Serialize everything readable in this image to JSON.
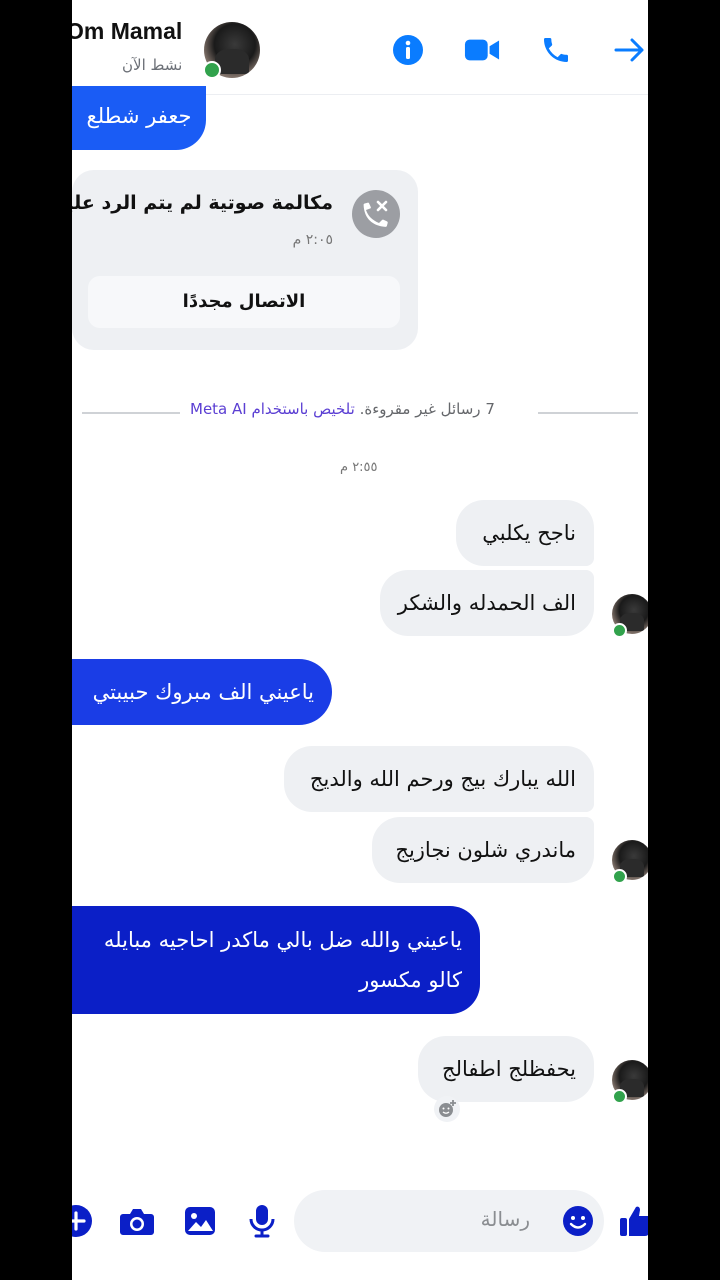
{
  "header": {
    "contact_name": "Om Mamal",
    "status": "نشط الآن"
  },
  "messages": {
    "top_sent": "جعفر شطلع",
    "missed_call": {
      "title": "مكالمة صوتية لم يتم الرد عليها",
      "time": "٢:٠٥ م",
      "callback_label": "الاتصال مجددًا"
    },
    "unread_count_text": "7 رسائل غير مقروءة.",
    "meta_summary_text": "تلخيص باستخدام Meta AI",
    "timestamp": "٢:٥٥ م",
    "recv_1": "ناجح يكلبي",
    "recv_2": "الف الحمدله والشكر",
    "sent_1": "ياعيني الف مبروك حبيبتي",
    "recv_3": "الله يبارك بيج ورحم الله والديج",
    "recv_4": "ماندري شلون نجازيج",
    "sent_2_line1": "ياعيني والله ضل بالي ماكدر احاجيه مبايله",
    "sent_2_line2": "كالو مكسور",
    "recv_5": "يحفظلج اطفالج"
  },
  "composer": {
    "placeholder": "رسالة"
  },
  "colors": {
    "accent": "#0a7cff",
    "sent_light": "#1a5cf5",
    "sent_dark": "#0b1fc7",
    "received": "#eef0f3",
    "meta_ai": "#5b3fd3",
    "online": "#31a24c"
  },
  "icons": [
    "info-icon",
    "video-camera-icon",
    "phone-icon",
    "arrow-icon",
    "missed-call-icon",
    "add-reaction-icon",
    "plus-icon",
    "camera-icon",
    "gallery-icon",
    "microphone-icon",
    "emoji-icon",
    "thumbs-up-icon"
  ]
}
